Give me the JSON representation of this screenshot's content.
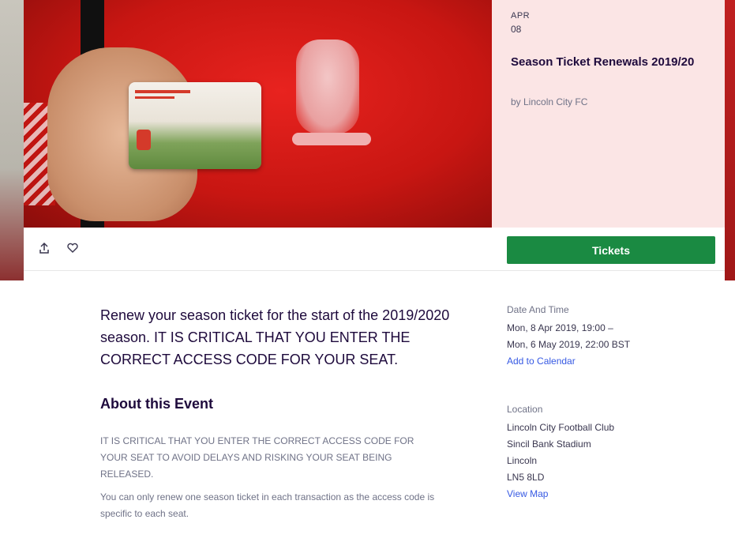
{
  "event": {
    "month": "APR",
    "day": "08",
    "title": "Season Ticket Renewals 2019/20",
    "organizer": "by Lincoln City FC"
  },
  "actions": {
    "tickets_label": "Tickets",
    "share_icon": "share-icon",
    "like_icon": "heart-icon"
  },
  "content": {
    "summary": "Renew your season ticket for the start of the 2019/2020 season. IT IS CRITICAL THAT YOU ENTER THE CORRECT ACCESS CODE FOR YOUR SEAT.",
    "about_heading": "About this Event",
    "about_p1": "IT IS CRITICAL THAT YOU ENTER THE CORRECT ACCESS CODE FOR YOUR SEAT TO AVOID DELAYS AND RISKING YOUR SEAT BEING RELEASED.",
    "about_p2": "You can only renew one season ticket in each transaction as the access code is specific to each seat."
  },
  "date_time": {
    "heading": "Date And Time",
    "line1": "Mon, 8 Apr 2019, 19:00 –",
    "line2": "Mon, 6 May 2019, 22:00 BST",
    "calendar_link": "Add to Calendar"
  },
  "location": {
    "heading": "Location",
    "line1": "Lincoln City Football Club",
    "line2": "Sincil Bank Stadium",
    "line3": "Lincoln",
    "line4": "LN5 8LD",
    "map_link": "View Map"
  },
  "colors": {
    "tickets_button": "#1a8a42",
    "link": "#3659e3",
    "side_panel": "#fbe5e5"
  }
}
